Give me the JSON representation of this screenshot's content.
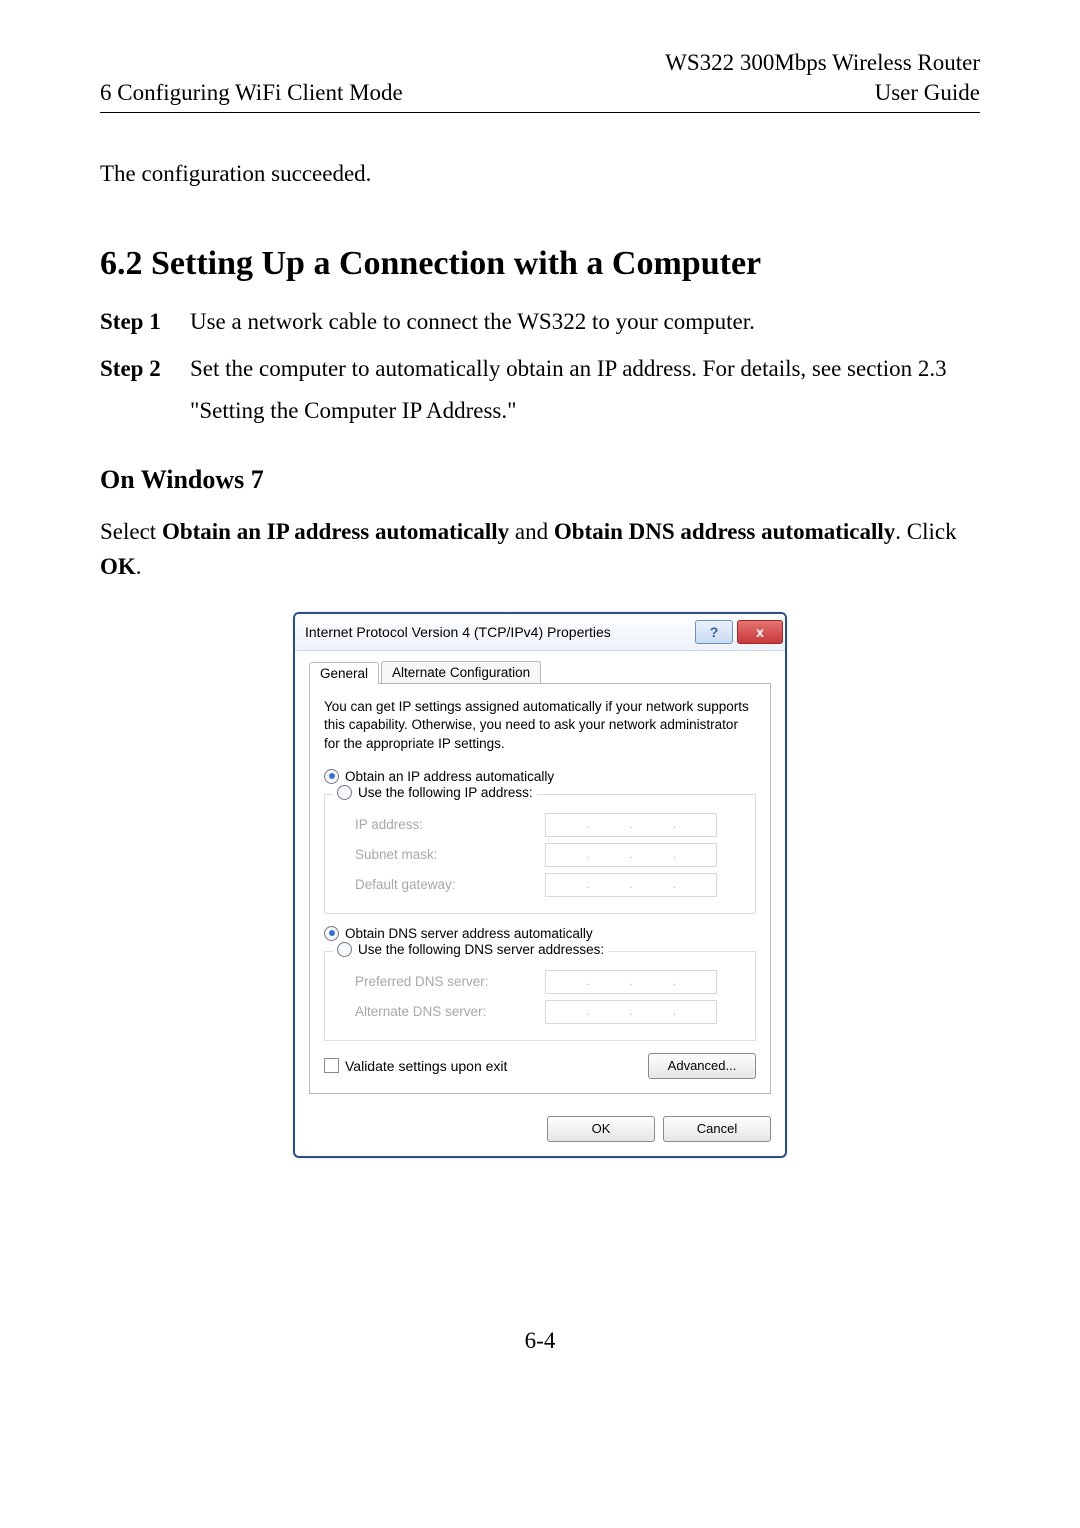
{
  "header": {
    "product": "WS322 300Mbps Wireless Router",
    "chapter": "6 Configuring WiFi Client Mode",
    "doc_type": "User Guide"
  },
  "intro_line": "The configuration succeeded.",
  "section": {
    "number_title": "6.2 Setting Up a Connection with a Computer",
    "steps": [
      {
        "label": "Step 1",
        "text": "Use a network cable to connect the WS322 to your computer."
      },
      {
        "label": "Step 2",
        "text": "Set the computer to automatically obtain an IP address. For details, see section 2.3 \"Setting the Computer IP Address.\""
      }
    ]
  },
  "subsection": {
    "title": "On Windows 7",
    "instruction_pre": "Select ",
    "bold1": "Obtain an IP address automatically",
    "mid1": " and ",
    "bold2": "Obtain DNS address automatically",
    "mid2": ". Click ",
    "bold3": "OK",
    "post": "."
  },
  "dialog": {
    "title": "Internet Protocol Version 4 (TCP/IPv4) Properties",
    "help_glyph": "?",
    "close_glyph": "x",
    "tabs": {
      "general": "General",
      "alt": "Alternate Configuration"
    },
    "description": "You can get IP settings assigned automatically if your network supports this capability. Otherwise, you need to ask your network administrator for the appropriate IP settings.",
    "radio_ip_auto": "Obtain an IP address automatically",
    "radio_ip_manual": "Use the following IP address:",
    "labels": {
      "ip": "IP address:",
      "mask": "Subnet mask:",
      "gw": "Default gateway:",
      "pdns": "Preferred DNS server:",
      "adns": "Alternate DNS server:"
    },
    "radio_dns_auto": "Obtain DNS server address automatically",
    "radio_dns_manual": "Use the following DNS server addresses:",
    "validate": "Validate settings upon exit",
    "advanced": "Advanced...",
    "ok": "OK",
    "cancel": "Cancel"
  },
  "page_number": "6-4"
}
